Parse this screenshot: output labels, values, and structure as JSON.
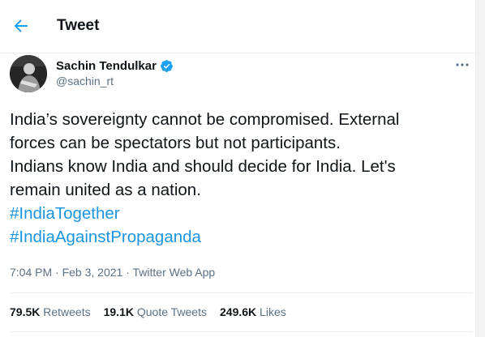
{
  "header": {
    "title": "Tweet"
  },
  "author": {
    "name": "Sachin Tendulkar",
    "handle": "@sachin_rt",
    "verified": true
  },
  "tweet": {
    "lines": [
      "India’s sovereignty cannot be compromised. External",
      "forces can be spectators but not participants.",
      "Indians know India and should decide for India. Let's",
      "remain united as a nation."
    ],
    "hashtags": [
      "#IndiaTogether",
      "#IndiaAgainstPropaganda"
    ]
  },
  "meta": {
    "time": "7:04 PM",
    "sep": "·",
    "date": "Feb 3, 2021",
    "source": "Twitter Web App"
  },
  "stats": {
    "retweets": {
      "value": "79.5K",
      "label": "Retweets"
    },
    "quotes": {
      "value": "19.1K",
      "label": "Quote Tweets"
    },
    "likes": {
      "value": "249.6K",
      "label": "Likes"
    }
  },
  "colors": {
    "accent": "#1da1f2",
    "link": "#1b95e0",
    "secondary_text": "#5b7083",
    "border": "#e6ecf0"
  },
  "icons": {
    "back": "arrow-left-icon",
    "verified": "verified-badge-icon",
    "more": "more-horizontal-icon"
  }
}
